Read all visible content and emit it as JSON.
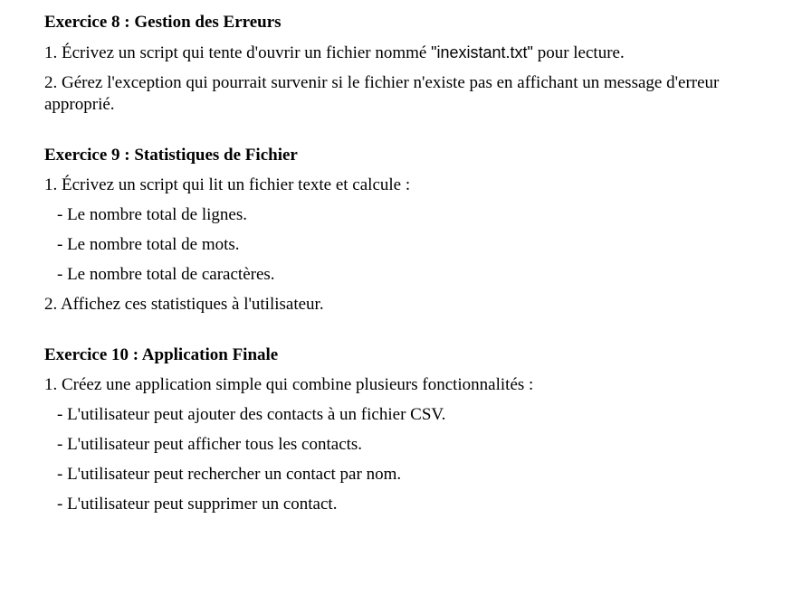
{
  "exercise8": {
    "title": "Exercice 8 : Gestion des Erreurs",
    "line1_pre": "1. Écrivez un script qui tente d'ouvrir un fichier nommé ",
    "line1_filename": "\"inexistant.txt\"",
    "line1_post": " pour lecture.",
    "line2": "2. Gérez l'exception qui pourrait survenir si le fichier n'existe pas en affichant un message d'erreur approprié."
  },
  "exercise9": {
    "title": "Exercice 9 : Statistiques de Fichier",
    "line1": "1. Écrivez un script qui lit un fichier texte et calcule :",
    "bullets": [
      "- Le nombre total de lignes.",
      "- Le nombre total de mots.",
      "- Le nombre total de caractères."
    ],
    "line2": "2. Affichez ces statistiques à l'utilisateur."
  },
  "exercise10": {
    "title": "Exercice 10 : Application Finale",
    "line1": "1. Créez une application simple qui combine plusieurs fonctionnalités :",
    "bullets": [
      "- L'utilisateur peut ajouter des contacts à un fichier CSV.",
      "- L'utilisateur peut afficher tous les contacts.",
      "- L'utilisateur peut rechercher un contact par nom.",
      "- L'utilisateur peut supprimer un contact."
    ]
  }
}
